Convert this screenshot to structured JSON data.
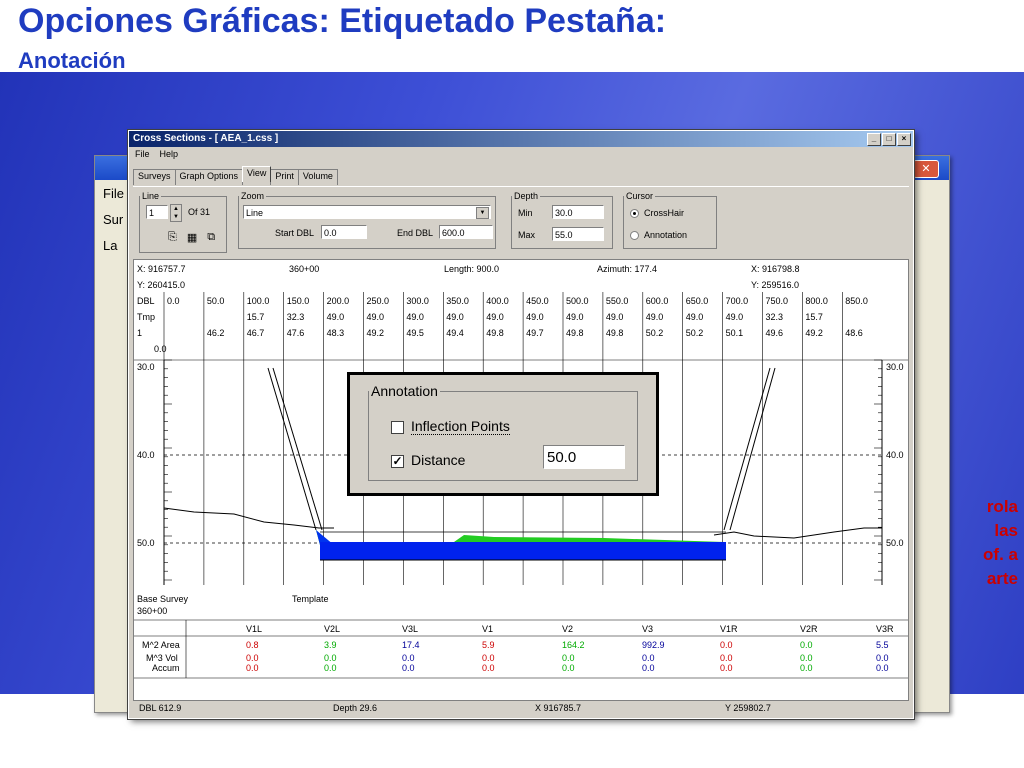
{
  "slide": {
    "title": "Opciones Gráficas: Etiquetado Pestaña:",
    "subtitle": "Anotación",
    "red_lines": [
      "rola",
      "las",
      "of. a",
      "arte"
    ]
  },
  "back_window": {
    "close_glyph": "✕",
    "left_labels": [
      "File",
      "Sur",
      "La"
    ]
  },
  "window": {
    "title": "Cross Sections - [ AEA_1.css ]",
    "controls": [
      "_",
      "□",
      "×"
    ],
    "menu": [
      "File",
      "Help"
    ],
    "tabs": [
      "Surveys",
      "Graph Options",
      "View",
      "Print",
      "Volume"
    ],
    "active_tab": "View"
  },
  "line_group": {
    "legend": "Line",
    "value": "1",
    "of_label": "Of 31"
  },
  "zoom_group": {
    "legend": "Zoom",
    "select_value": "Line",
    "start_label": "Start DBL",
    "start_value": "0.0",
    "end_label": "End DBL",
    "end_value": "600.0"
  },
  "depth_group": {
    "legend": "Depth",
    "min_label": "Min",
    "min_value": "30.0",
    "max_label": "Max",
    "max_value": "55.0"
  },
  "cursor_group": {
    "legend": "Cursor",
    "options": [
      "CrossHair",
      "Annotation"
    ],
    "selected": "CrossHair"
  },
  "chart_header": {
    "x_left": "X: 916757.7",
    "y_left": "Y: 260415.0",
    "station": "360+00",
    "length": "Length: 900.0",
    "azimuth": "Azimuth: 177.4",
    "x_right": "X: 916798.8",
    "y_right": "Y: 259516.0",
    "zero_label": "0.0"
  },
  "grid_rows": {
    "labels": [
      "DBL",
      "Tmp",
      "1"
    ],
    "dbl": [
      "0.0",
      "50.0",
      "100.0",
      "150.0",
      "200.0",
      "250.0",
      "300.0",
      "350.0",
      "400.0",
      "450.0",
      "500.0",
      "550.0",
      "600.0",
      "650.0",
      "700.0",
      "750.0",
      "800.0",
      "850.0"
    ],
    "tmp": [
      "",
      "",
      "15.7",
      "32.3",
      "49.0",
      "49.0",
      "49.0",
      "49.0",
      "49.0",
      "49.0",
      "49.0",
      "49.0",
      "49.0",
      "49.0",
      "49.0",
      "32.3",
      "15.7",
      ""
    ],
    "row1": [
      "",
      "46.2",
      "46.7",
      "47.6",
      "48.3",
      "49.2",
      "49.5",
      "49.4",
      "49.8",
      "49.7",
      "49.8",
      "49.8",
      "50.2",
      "50.2",
      "50.1",
      "49.6",
      "49.2",
      "48.6"
    ]
  },
  "depth_axis": [
    "30.0",
    "40.0",
    "50.0"
  ],
  "legend_labels": {
    "base_survey": "Base Survey",
    "base_station": "360+00",
    "template": "Template"
  },
  "volumes": {
    "columns": [
      "V1L",
      "V2L",
      "V3L",
      "V1",
      "V2",
      "V3",
      "V1R",
      "V2R",
      "V3R"
    ],
    "area_label": "M^2 Area",
    "area": [
      "0.8",
      "3.9",
      "17.4",
      "5.9",
      "164.2",
      "992.9",
      "0.0",
      "0.0",
      "5.5"
    ],
    "area_colors": [
      "#cc0000",
      "#00aa00",
      "#000099",
      "#cc0000",
      "#00aa00",
      "#000099",
      "#cc0000",
      "#00aa00",
      "#000099"
    ],
    "vol_label": "M^3 Vol",
    "vol": [
      "0.0",
      "0.0",
      "0.0",
      "0.0",
      "0.0",
      "0.0",
      "0.0",
      "0.0",
      "0.0"
    ],
    "accum_label": "Accum",
    "accum": [
      "0.0",
      "0.0",
      "0.0",
      "0.0",
      "0.0",
      "0.0",
      "0.0",
      "0.0",
      "0.0"
    ]
  },
  "status_bar": {
    "dbl": "DBL 612.9",
    "depth": "Depth 29.6",
    "x": "X 916785.7",
    "y": "Y 259802.7"
  },
  "annotation_dialog": {
    "legend": "Annotation",
    "inflection_label": "Inflection Points",
    "inflection_checked": false,
    "distance_label": "Distance",
    "distance_checked": true,
    "distance_value": "50.0"
  }
}
